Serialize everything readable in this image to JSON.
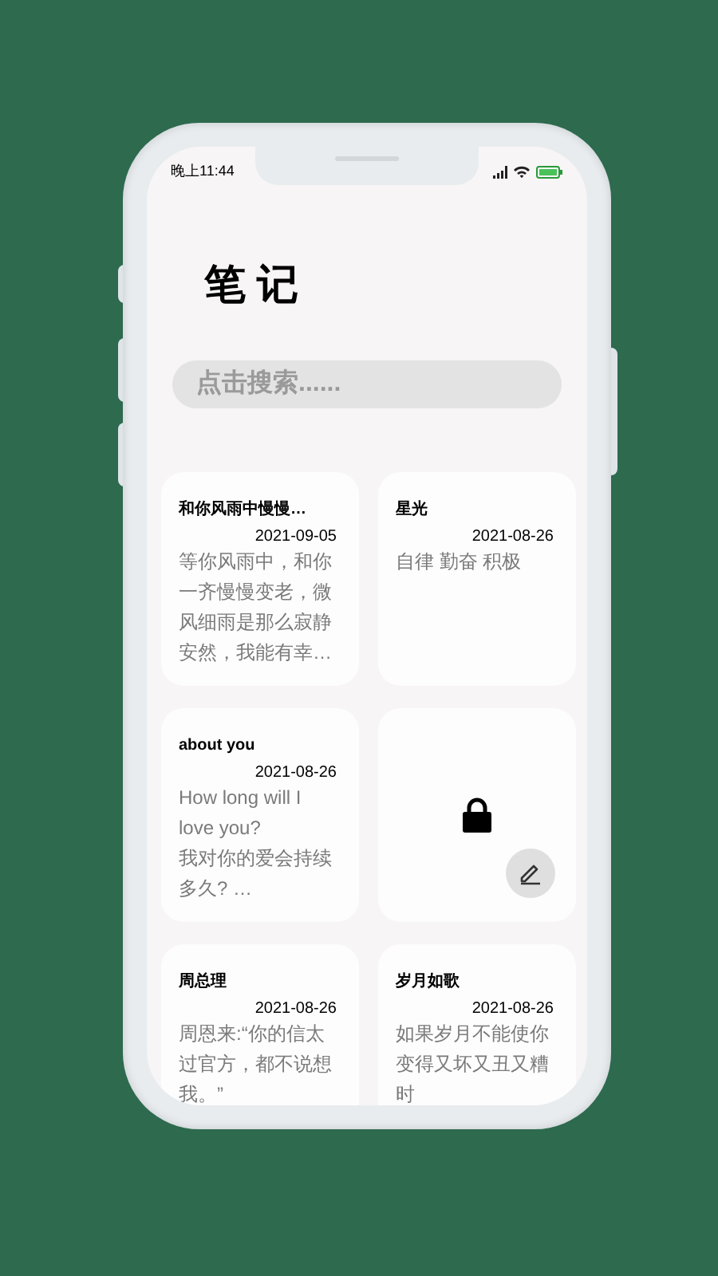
{
  "status_bar": {
    "time": "晚上11:44"
  },
  "title": "笔 记",
  "search": {
    "placeholder": "点击搜索......"
  },
  "notes": [
    {
      "kind": "note",
      "title": "和你风雨中慢慢…",
      "date": "2021-09-05",
      "body": "等你风雨中，和你一齐慢慢变老，微风细雨是那么寂静安然，我能有幸…"
    },
    {
      "kind": "note",
      "title": "星光",
      "date": "2021-08-26",
      "body": "自律 勤奋 积极"
    },
    {
      "kind": "note",
      "title": "about you",
      "date": "2021-08-26",
      "body": "How long will I love you?\n我对你的爱会持续多久?  …"
    },
    {
      "kind": "locked"
    },
    {
      "kind": "note",
      "title": "周总理",
      "date": "2021-08-26",
      "body": "周恩来:“你的信太过官方，都不说想我。”"
    },
    {
      "kind": "note",
      "title": "岁月如歌",
      "date": "2021-08-26",
      "body": "如果岁月不能使你变得又坏又丑又糟时"
    }
  ]
}
